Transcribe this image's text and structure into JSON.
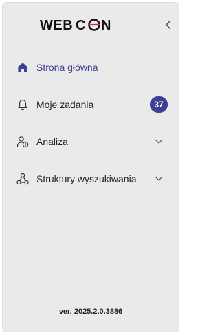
{
  "brand": {
    "logo_text": "WEBCON",
    "accent_color": "#3c3f93",
    "logo_ring_color": "#d7263d"
  },
  "header": {
    "collapse_icon": "chevron-left-icon"
  },
  "nav": {
    "items": [
      {
        "label": "Strona główna",
        "icon": "home-icon",
        "active": true
      },
      {
        "label": "Moje zadania",
        "icon": "bell-icon",
        "badge": "37"
      },
      {
        "label": "Analiza",
        "icon": "user-analytics-icon",
        "expandable": true
      },
      {
        "label": "Struktury wyszukiwania",
        "icon": "hierarchy-icon",
        "expandable": true
      }
    ]
  },
  "footer": {
    "version": "ver. 2025.2.0.3886"
  }
}
